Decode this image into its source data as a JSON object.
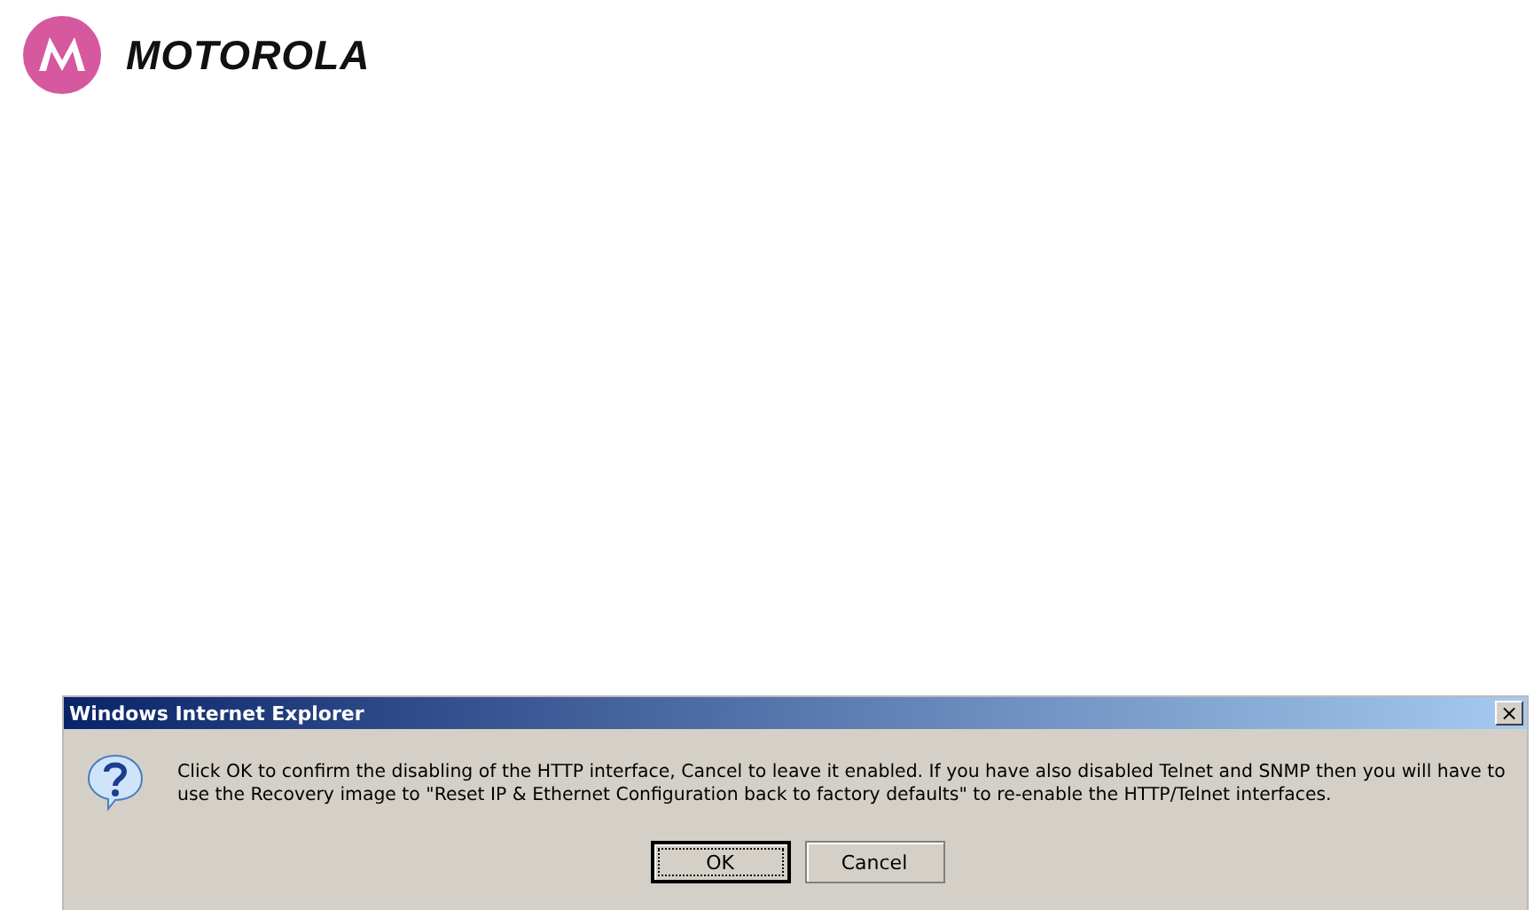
{
  "logo": {
    "text": "MOTOROLA"
  },
  "dialog": {
    "title": "Windows Internet Explorer",
    "close": "×",
    "message": "Click OK to confirm the disabling of the HTTP interface, Cancel to leave it enabled.  If you have also disabled Telnet and SNMP then you will have to use the Recovery image to \"Reset IP & Ethernet Configuration back to factory defaults\" to re-enable the HTTP/Telnet interfaces.",
    "buttons": [
      {
        "label": "OK",
        "default": true
      },
      {
        "label": "Cancel",
        "default": false
      }
    ]
  }
}
